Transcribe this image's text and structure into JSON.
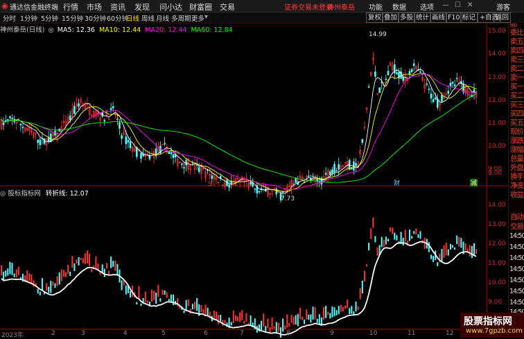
{
  "app": {
    "title": "通达信金融终端",
    "notice": "证券交易未登录",
    "stock_name": "神州泰岳",
    "user": "游客"
  },
  "menu": [
    "行情",
    "市场",
    "资讯",
    "发现",
    "问小达",
    "财富圈",
    "交易"
  ],
  "menu_right": [
    "功能",
    "数据",
    "选项"
  ],
  "periods": [
    "分时",
    "1分钟",
    "5分钟",
    "15分钟",
    "30分钟",
    "60分钟",
    "日线",
    "周线",
    "月线",
    "多周期",
    "更多"
  ],
  "active_period": "日线",
  "tools": [
    "复权",
    "叠加",
    "多股",
    "统计",
    "画线",
    "F10",
    "标记",
    "+自选",
    "返回"
  ],
  "main_info": {
    "name": "神州泰岳(日线)",
    "ma5": "MA5: 12.36",
    "ma10": "MA10: 12.44",
    "ma20": "MA20: 12.44",
    "ma60": "MA60: 12.84"
  },
  "sub_info": {
    "name": "股标指标网",
    "line": "转折线: 12.07"
  },
  "price_axis": [
    "15.00",
    "14.00",
    "13.00",
    "12.00",
    "11.00",
    "10.00",
    "9.00",
    "8.00"
  ],
  "sub_axis": [
    "14.00",
    "13.00",
    "12.00",
    "11.00",
    "10.00",
    "9.00"
  ],
  "annotations": {
    "high": "14.99",
    "low": "7.73",
    "marker_s": "S",
    "marker_cai": "财",
    "marker_jian": "减"
  },
  "x_axis": [
    "2023年",
    "2",
    "3",
    "4",
    "5",
    "6",
    "7",
    "8",
    "9",
    "10",
    "11",
    "12"
  ],
  "side_tabs": [
    "委比",
    "卖五",
    "卖四",
    "卖三",
    "卖二",
    "卖一",
    "买一",
    "买二",
    "买三",
    "买四",
    "买五",
    "现价",
    "涨跌",
    "涨幅",
    "总量",
    "外盘",
    "换手",
    "净资",
    "收益"
  ],
  "side_bottom": [
    "自动",
    "交易",
    "14:50",
    "14:50",
    "14:50",
    "14:50",
    "14:50",
    "14:50",
    "14:50",
    "14:50"
  ],
  "side_top_value": "500",
  "watermark": {
    "line1": "股票指标网",
    "line2": "www.7gpzb.com"
  },
  "colors": {
    "up": "#ff3232",
    "down": "#54ffff",
    "ma5": "#ffffff",
    "ma10": "#ffff00",
    "ma20": "#ff00ff",
    "ma60": "#00ff00",
    "axis": "#b00000"
  }
}
